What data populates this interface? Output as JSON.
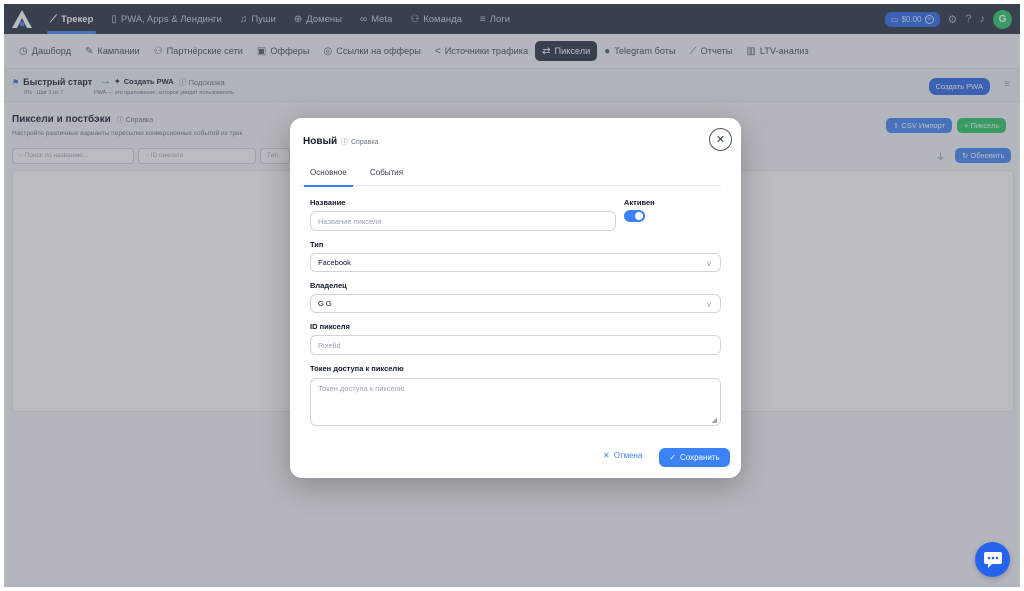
{
  "topnav": {
    "items": [
      {
        "label": "Трекер",
        "icon": "chart-line-icon"
      },
      {
        "label": "PWA, Apps & Лендинги",
        "icon": "phone-icon"
      },
      {
        "label": "Пуши",
        "icon": "bell-icon"
      },
      {
        "label": "Домены",
        "icon": "globe-icon"
      },
      {
        "label": "Meta",
        "icon": "infinity-icon"
      },
      {
        "label": "Команда",
        "icon": "team-icon"
      },
      {
        "label": "Логи",
        "icon": "list-icon"
      }
    ],
    "balance": "$0.00"
  },
  "subnav": {
    "items": [
      {
        "label": "Дашборд",
        "icon": "clock-icon"
      },
      {
        "label": "Кампании",
        "icon": "edit-icon"
      },
      {
        "label": "Партнёрские сети",
        "icon": "people-icon"
      },
      {
        "label": "Офферы",
        "icon": "gift-icon"
      },
      {
        "label": "Ссылки на офферы",
        "icon": "pin-icon"
      },
      {
        "label": "Источники трафика",
        "icon": "share-icon"
      },
      {
        "label": "Пиксели",
        "icon": "swap-icon"
      },
      {
        "label": "Telegram боты",
        "icon": "telegram-icon"
      },
      {
        "label": "Отчеты",
        "icon": "chart-icon"
      },
      {
        "label": "LTV-анализ",
        "icon": "bars-icon"
      }
    ]
  },
  "quickstart": {
    "title": "Быстрый старт",
    "progress": "0% · Шаг 1 из 7",
    "step": "Создать PWA",
    "hint": "Подсказка",
    "hint_text": "PWA — это приложение, которое увидит пользователь",
    "create_button": "Создать PWA"
  },
  "page": {
    "title": "Пиксели и постбэки",
    "help": "Справка",
    "description": "Настройте различные варианты пересылки конверсионных событий из трек",
    "csv_button": "CSV Импорт",
    "pixel_button": "+ Пиксель",
    "search_placeholder": "Поиск по названию...",
    "id_placeholder": "ID пикселя",
    "type_placeholder": "Тип",
    "refresh_button": "Обновить"
  },
  "modal": {
    "title": "Новый",
    "help": "Справка",
    "tabs": [
      "Основное",
      "События"
    ],
    "name_label": "Название",
    "name_placeholder": "Название пикселя",
    "active_label": "Активен",
    "type_label": "Тип",
    "type_value": "Facebook",
    "owner_label": "Владелец",
    "owner_value": "G G",
    "pixel_id_label": "ID пикселя",
    "pixel_id_placeholder": "PixelId",
    "token_label": "Токен доступа к пикселю",
    "token_placeholder": "Токен доступа к пикселю",
    "cancel": "Отмена",
    "save": "Сохранить"
  },
  "user": {
    "initial": "G"
  },
  "colors": {
    "accent": "#3b82f6",
    "nav_bg": "#1f2937",
    "success": "#22c55e"
  }
}
